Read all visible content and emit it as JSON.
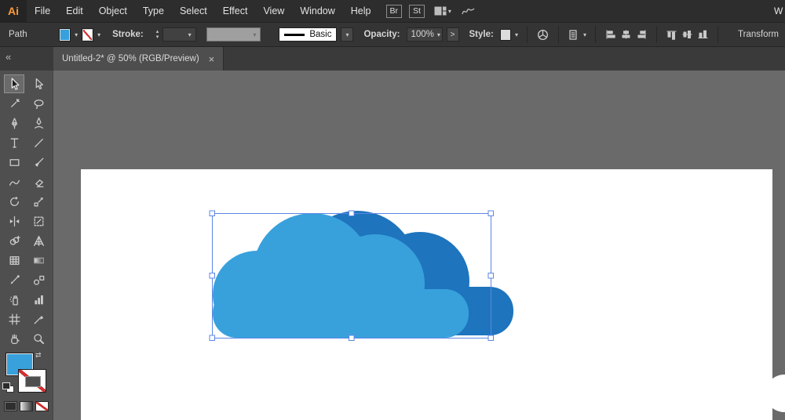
{
  "app": {
    "logo": "Ai",
    "menus": [
      "File",
      "Edit",
      "Object",
      "Type",
      "Select",
      "Effect",
      "View",
      "Window",
      "Help"
    ],
    "bridge_label": "Br",
    "stock_label": "St",
    "workspace_partial": "W"
  },
  "control_bar": {
    "selection_type": "Path",
    "stroke_label": "Stroke:",
    "brush_definition": "Basic",
    "opacity_label": "Opacity:",
    "opacity_value": "100%",
    "more_options_glyph": ">",
    "style_label": "Style:",
    "transform_label": "Transform"
  },
  "document_tab": {
    "title": "Untitled-2* @ 50% (RGB/Preview)",
    "close_glyph": "×",
    "collapse_glyph": "«"
  },
  "glyphs": {
    "dropdown": "▾",
    "spinner_up": "▴",
    "spinner_down": "▾",
    "swap": "⇄"
  },
  "tools": [
    "selection",
    "direct-selection",
    "magic-wand",
    "lasso",
    "pen",
    "curvature",
    "type",
    "line-segment",
    "rectangle",
    "paintbrush",
    "shaper",
    "eraser",
    "rotate",
    "scale",
    "width",
    "free-transform",
    "shape-builder",
    "perspective-grid",
    "mesh",
    "gradient",
    "eyedropper",
    "blend",
    "symbol-sprayer",
    "column-graph",
    "artboard",
    "slice",
    "hand",
    "zoom"
  ],
  "colors": {
    "cloud_front": "#38a1dc",
    "cloud_back": "#1e74bd",
    "selection_accent": "#5b87e5",
    "fill_swatch": "#38a1dc"
  }
}
